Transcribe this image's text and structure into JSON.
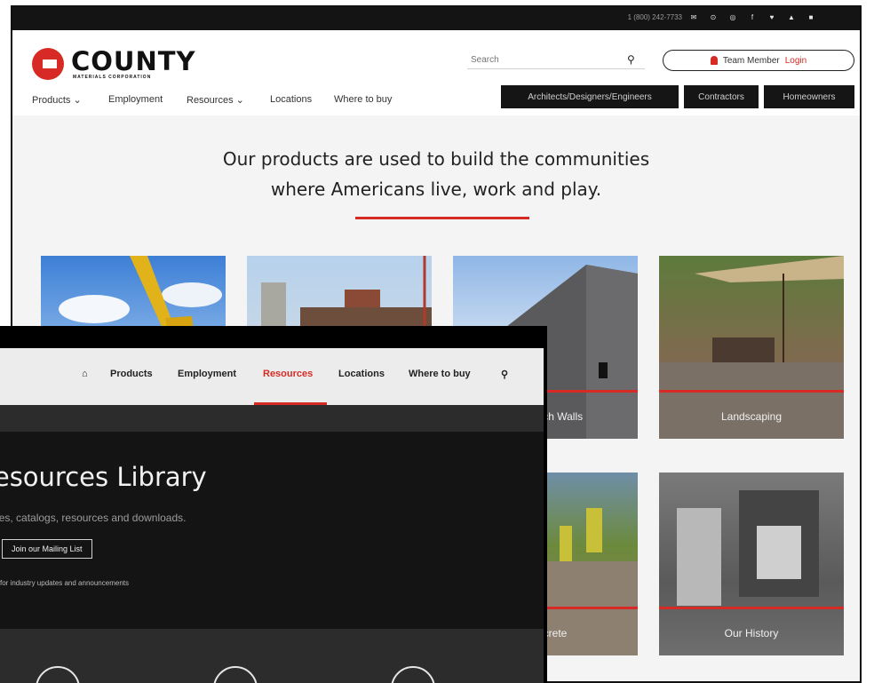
{
  "topbar": {
    "phone": "1 (800) 242-7733",
    "social_icons": [
      "email-icon",
      "location-icon",
      "instagram-icon",
      "facebook-icon",
      "twitter-icon",
      "youtube-icon",
      "linkedin-icon"
    ]
  },
  "header": {
    "logo_text": "COUNTY",
    "logo_subtext": "MATERIALS CORPORATION",
    "search_placeholder": "Search",
    "login_prefix": "Team Member",
    "login_link": "Login"
  },
  "nav": {
    "items": [
      "Products ⌄",
      "Employment",
      "Resources ⌄",
      "Locations",
      "Where to buy"
    ]
  },
  "audience": {
    "items": [
      "Architects/Designers/Engineers",
      "Contractors",
      "Homeowners"
    ]
  },
  "hero": {
    "line1": "Our products are used to build the communities",
    "line2": "where Americans live, work and play."
  },
  "tiles": {
    "labels": [
      "Sandwich Walls",
      "Landscaping",
      "Concrete",
      "Our History"
    ]
  },
  "front": {
    "nav": [
      "Products",
      "Employment",
      "Resources",
      "Locations",
      "Where to buy"
    ],
    "title": "Resources Library",
    "subtitle": "guides, catalogs, resources and downloads.",
    "mailing_button": "Join our Mailing List",
    "note": "for industry updates and announcements"
  },
  "colors": {
    "accent": "#d72a25",
    "dark": "#141414"
  }
}
